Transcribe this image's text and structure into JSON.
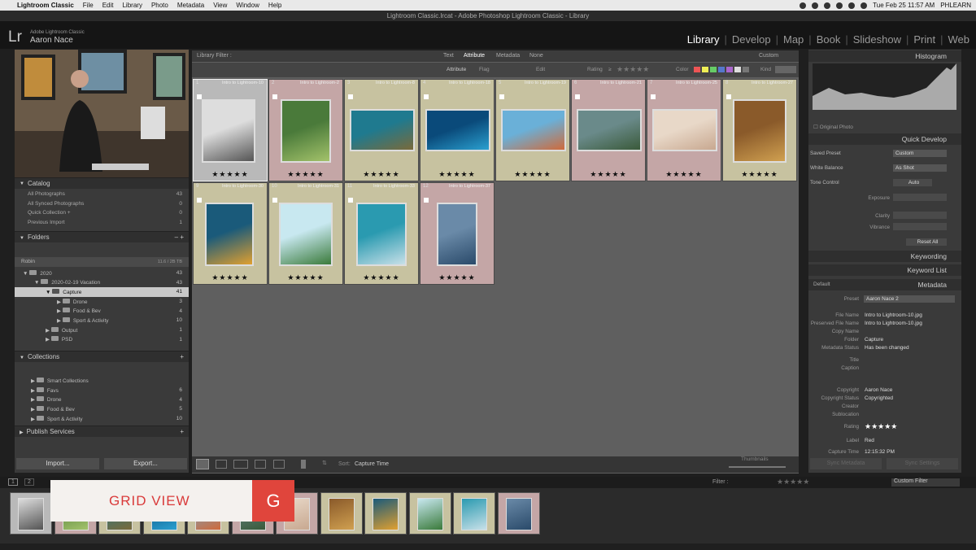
{
  "menubar": {
    "apple": "",
    "app": "Lightroom Classic",
    "items": [
      "File",
      "Edit",
      "Library",
      "Photo",
      "Metadata",
      "View",
      "Window",
      "Help"
    ],
    "datetime": "Tue Feb 25  11:57 AM",
    "user": "PHLEARN"
  },
  "window_title": "Lightroom Classic.lrcat - Adobe Photoshop Lightroom Classic - Library",
  "identity": {
    "logo": "Lr",
    "product": "Adobe Lightroom Classic",
    "name": "Aaron Nace"
  },
  "modules": [
    "Library",
    "Develop",
    "Map",
    "Book",
    "Slideshow",
    "Print",
    "Web"
  ],
  "catalog": {
    "title": "Catalog",
    "rows": [
      {
        "label": "All Photographs",
        "count": "43"
      },
      {
        "label": "All Synced Photographs",
        "count": "0"
      },
      {
        "label": "Quick Collection +",
        "count": "0"
      },
      {
        "label": "Previous Import",
        "count": "1"
      }
    ]
  },
  "folders": {
    "title": "Folders",
    "volume": "Robin",
    "volume_info": "11.6 / 2B TB",
    "tree": [
      {
        "label": "2020",
        "count": "43",
        "indent": "1"
      },
      {
        "label": "2020-02-19 Vacation",
        "count": "43",
        "indent": "2"
      },
      {
        "label": "Capture",
        "count": "41",
        "indent": "3",
        "selected": "1"
      },
      {
        "label": "Drone",
        "count": "3",
        "indent": "4"
      },
      {
        "label": "Food & Bev",
        "count": "4",
        "indent": "4"
      },
      {
        "label": "Sport & Activity",
        "count": "10",
        "indent": "4"
      },
      {
        "label": "Output",
        "count": "1",
        "indent": "3"
      },
      {
        "label": "PSD",
        "count": "1",
        "indent": "3"
      }
    ]
  },
  "collections": {
    "title": "Collections",
    "rows": [
      {
        "label": "Smart Collections",
        "count": ""
      },
      {
        "label": "Favs",
        "count": "6"
      },
      {
        "label": "Drone",
        "count": "4"
      },
      {
        "label": "Food & Bev",
        "count": "5"
      },
      {
        "label": "Sport & Activity",
        "count": "10"
      }
    ]
  },
  "publish": {
    "title": "Publish Services"
  },
  "left_buttons": {
    "import": "Import...",
    "export": "Export..."
  },
  "filter": {
    "title": "Library Filter :",
    "tabs": [
      "Text",
      "Attribute",
      "Metadata",
      "None"
    ],
    "preset": "Custom"
  },
  "attribute_bar": {
    "attribute": "Attribute",
    "flag": "Flag",
    "edit": "Edit",
    "rating": "Rating",
    "rating_op": "≥",
    "color": "Color",
    "kind": "Kind"
  },
  "grid": [
    {
      "num": "1",
      "file": "Intro to Lightroom-10",
      "stars": "★★★★★",
      "tint": "#b9b9b9"
    },
    {
      "num": "2",
      "file": "Intro to Lightroom-2",
      "stars": "★★★★★",
      "tint": "#c4a6a6"
    },
    {
      "num": "3",
      "file": "Intro to Lightroom-8",
      "stars": "★★★★★",
      "tint": "#c7c2a0"
    },
    {
      "num": "4",
      "file": "Intro to Lightroom-18",
      "stars": "★★★★★",
      "tint": "#c7c2a0"
    },
    {
      "num": "5",
      "file": "Intro to Lightroom-19",
      "stars": "★★★★★",
      "tint": "#c7c2a0"
    },
    {
      "num": "6",
      "file": "Intro to Lightroom-21",
      "stars": "★★★★★",
      "tint": "#c4a6a6"
    },
    {
      "num": "7",
      "file": "Intro to Lightroom-25",
      "stars": "★★★★★",
      "tint": "#c4a6a6"
    },
    {
      "num": "8",
      "file": "Intro to Lightroom-27",
      "stars": "★★★★★",
      "tint": "#c7c2a0"
    },
    {
      "num": "9",
      "file": "Intro to Lightroom-30",
      "stars": "★★★★★",
      "tint": "#c7c2a0"
    },
    {
      "num": "10",
      "file": "Intro to Lightroom-31",
      "stars": "★★★★★",
      "tint": "#c7c2a0"
    },
    {
      "num": "11",
      "file": "Intro to Lightroom-33",
      "stars": "★★★★★",
      "tint": "#c7c2a0"
    },
    {
      "num": "12",
      "file": "Intro to Lightroom-37",
      "stars": "★★★★★",
      "tint": "#c4a6a6"
    }
  ],
  "toolbar": {
    "sort_label": "Sort:",
    "sort_value": "Capture Time",
    "thumbs_label": "Thumbnails"
  },
  "histogram": {
    "title": "Histogram",
    "original": "Original Photo"
  },
  "quick_develop": {
    "title": "Quick Develop",
    "saved_preset": "Saved Preset",
    "saved_preset_value": "Custom",
    "white_balance": "White Balance",
    "white_balance_value": "As Shot",
    "tone_control": "Tone Control",
    "auto": "Auto",
    "exposure": "Exposure",
    "clarity": "Clarity",
    "vibrance": "Vibrance",
    "reset": "Reset All"
  },
  "keywording": {
    "title": "Keywording"
  },
  "keyword_list": {
    "title": "Keyword List"
  },
  "metadata": {
    "title": "Metadata",
    "mode": "Default",
    "preset_label": "Preset",
    "preset": "Aaron Nace 2",
    "rows": [
      {
        "label": "File Name",
        "value": "Intro to Lightroom-10.jpg"
      },
      {
        "label": "Preserved File Name",
        "value": "Intro to Lightroom-10.jpg"
      },
      {
        "label": "Copy Name",
        "value": ""
      },
      {
        "label": "Folder",
        "value": "Capture"
      },
      {
        "label": "Metadata Status",
        "value": "Has been changed"
      },
      {
        "label": "Title",
        "value": ""
      },
      {
        "label": "Caption",
        "value": ""
      },
      {
        "label": "Copyright",
        "value": "Aaron Nace"
      },
      {
        "label": "Copyright Status",
        "value": "Copyrighted"
      },
      {
        "label": "Creator",
        "value": ""
      },
      {
        "label": "Sublocation",
        "value": ""
      },
      {
        "label": "Rating",
        "value": "★★★★★"
      },
      {
        "label": "Label",
        "value": "Red"
      },
      {
        "label": "Capture Time",
        "value": "12:15:32 PM"
      }
    ]
  },
  "right_buttons": {
    "sync_meta": "Sync Metadata",
    "sync_settings": "Sync Settings"
  },
  "filmstrip": {
    "page1": "1",
    "page2": "2",
    "filter_label": "Filter :",
    "filter_value": "Custom Filter"
  },
  "overlay": {
    "text": "GRID VIEW",
    "key": "G"
  }
}
